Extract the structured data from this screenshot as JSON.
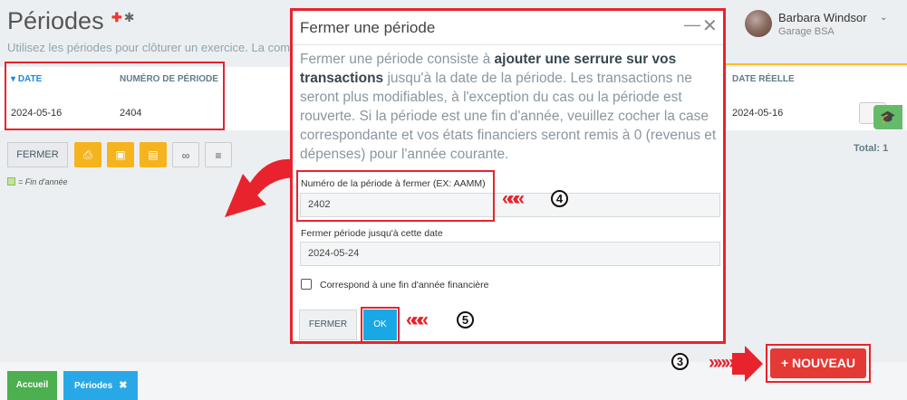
{
  "header": {
    "title": "Périodes",
    "subtitle": "Utilisez les périodes pour clôturer un exercice. La comptabilité",
    "add_icon": "plus-circle-icon",
    "settings_icon": "gear-icon"
  },
  "user": {
    "name": "Barbara Windsor",
    "company": "Garage BSA",
    "caret": "⌄"
  },
  "table": {
    "columns": {
      "date": "DATE",
      "sort_indicator": "▾",
      "period_number": "NUMÉRO DE PÉRIODE",
      "real_date": "DATE RÉELLE"
    },
    "rows": [
      {
        "date": "2024-05-16",
        "period_number": "2404",
        "real_date": "2024-05-16"
      }
    ],
    "total": "Total: 1"
  },
  "toolbar": {
    "fermer_label": "FERMER",
    "icons": [
      "print-icon",
      "excel-icon",
      "pdf-icon",
      "link-icon",
      "list-icon"
    ]
  },
  "legend": {
    "text": "= Fin d'année"
  },
  "modal": {
    "title": "Fermer une période",
    "minimize": "—",
    "close": "✕",
    "desc_part1": "Fermer une période consiste à ",
    "desc_bold": "ajouter une serrure sur vos transactions",
    "desc_part2": " jusqu'à la date de la période. Les transactions ne seront plus modifiables, à l'exception du cas ou la période est rouverte. Si la période est une fin d'année, veuillez cocher la case correspondante et vos états financiers seront remis à 0 (revenus et dépenses) pour l'année courante.",
    "period_label": "Numéro de la période à fermer (EX: AAMM)",
    "period_value": "2402",
    "date_label": "Fermer période jusqu'à cette date",
    "date_value": "2024-05-24",
    "checkbox_label": "Correspond à une fin d'année financière",
    "checkbox_checked": false,
    "cancel_label": "FERMER",
    "ok_label": "OK"
  },
  "annotations": {
    "step3": "3",
    "step4": "4",
    "step5": "5",
    "chevrons": "«««",
    "chevrons_right": "»»»"
  },
  "nouveau_button": {
    "label": "+ NOUVEAU"
  },
  "tabs": [
    {
      "label": "Accueil"
    },
    {
      "label": "Périodes",
      "close": "✖"
    }
  ],
  "colors": {
    "annotation_red": "#e8232d",
    "primary_blue": "#19a8e6",
    "warning_yellow": "#f5b41e",
    "danger_red": "#e53935",
    "success_green": "#4caf50"
  }
}
